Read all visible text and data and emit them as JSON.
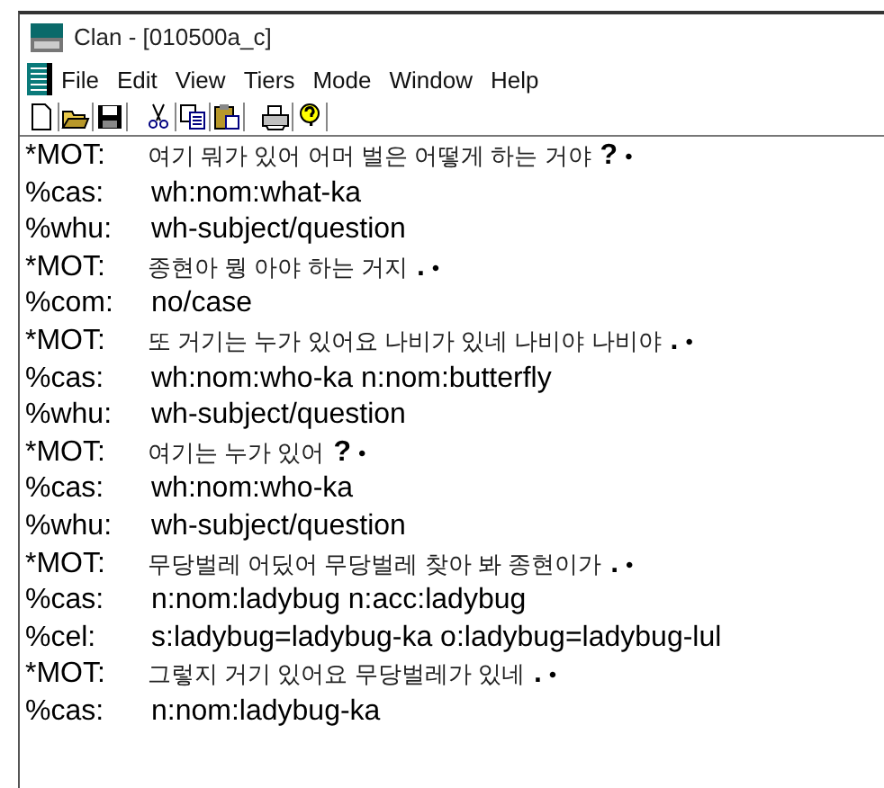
{
  "window": {
    "title": "Clan - [010500a_c]"
  },
  "menu": [
    "File",
    "Edit",
    "View",
    "Tiers",
    "Mode",
    "Window",
    "Help"
  ],
  "toolbar": [
    {
      "kind": "new"
    },
    {
      "kind": "open"
    },
    {
      "kind": "save"
    },
    {
      "kind": "separator"
    },
    {
      "kind": "cut"
    },
    {
      "kind": "copy"
    },
    {
      "kind": "paste"
    },
    {
      "kind": "separator"
    },
    {
      "kind": "print"
    },
    {
      "kind": "help"
    }
  ],
  "lines": [
    {
      "kind": "main",
      "tier": "*MOT:",
      "text": "여기 뭐가 있어 어머 벌은 어떻게 하는 거야",
      "terminator": "?",
      "bullet": "•"
    },
    {
      "kind": "dependent",
      "tier": "%cas:",
      "text": "wh:nom:what-ka"
    },
    {
      "kind": "dependent",
      "tier": "%whu:",
      "text": "wh-subject/question"
    },
    {
      "kind": "main",
      "tier": "*MOT:",
      "text": "종현아 뭥 아야 하는 거지",
      "terminator": ".",
      "bullet": "•"
    },
    {
      "kind": "dependent",
      "tier": "%com:",
      "text": "no/case"
    },
    {
      "kind": "main",
      "tier": "*MOT:",
      "text": "또 거기는 누가 있어요 나비가 있네 나비야 나비야",
      "terminator": ".",
      "bullet": "•"
    },
    {
      "kind": "dependent",
      "tier": "%cas:",
      "text": "wh:nom:who-ka n:nom:butterfly"
    },
    {
      "kind": "dependent",
      "tier": "%whu:",
      "text": "wh-subject/question"
    },
    {
      "kind": "main",
      "tier": "*MOT:",
      "text": "여기는 누가 있어",
      "terminator": "?",
      "bullet": "•"
    },
    {
      "kind": "dependent",
      "tier": "%cas:",
      "text": "wh:nom:who-ka"
    },
    {
      "kind": "dependent",
      "tier": "%whu:",
      "text": "wh-subject/question"
    },
    {
      "kind": "main",
      "tier": "*MOT:",
      "text": "무당벌레 어딨어 무당벌레 찾아 봐 종현이가",
      "terminator": ".",
      "bullet": "•"
    },
    {
      "kind": "dependent",
      "tier": "%cas:",
      "text": "n:nom:ladybug n:acc:ladybug"
    },
    {
      "kind": "dependent",
      "tier": "%cel:",
      "text": "s:ladybug=ladybug-ka o:ladybug=ladybug-lul"
    },
    {
      "kind": "main",
      "tier": "*MOT:",
      "text": "그렇지 거기 있어요 무당벌레가 있네",
      "terminator": ".",
      "bullet": "•"
    },
    {
      "kind": "dependent",
      "tier": "%cas:",
      "text": "n:nom:ladybug-ka"
    }
  ]
}
